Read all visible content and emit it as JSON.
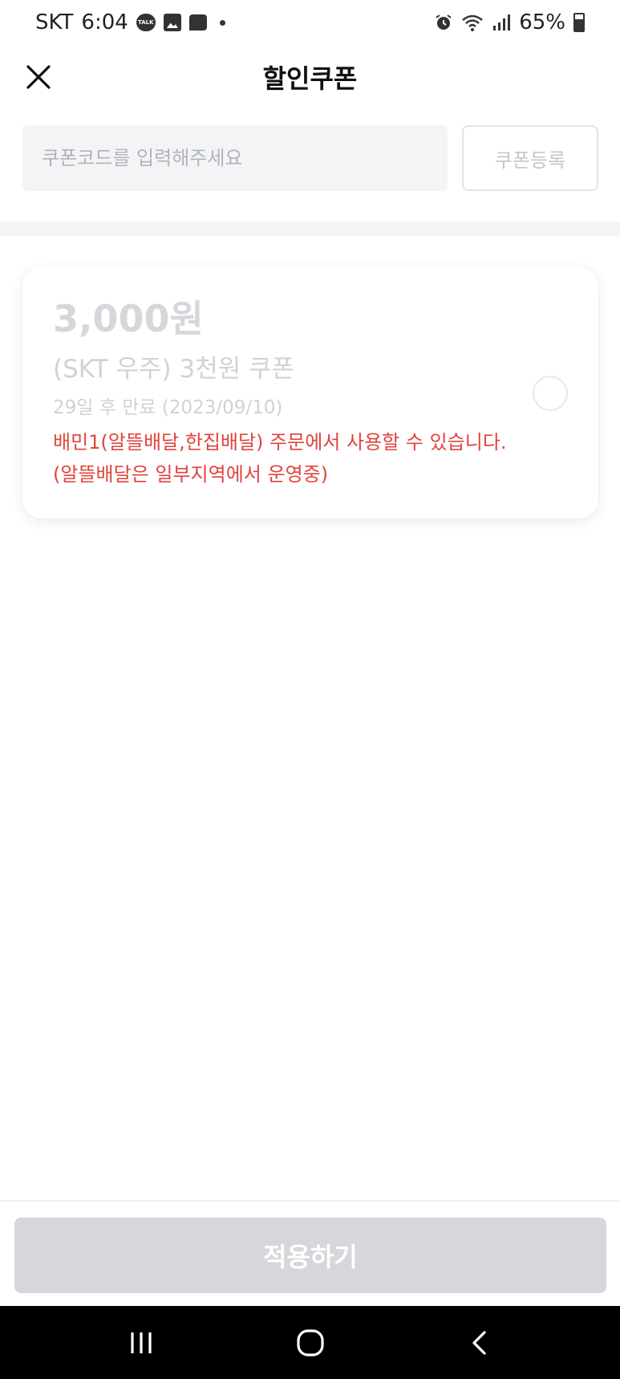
{
  "status_bar": {
    "carrier": "SKT",
    "time": "6:04",
    "talk_badge": "TALK",
    "battery": "65%"
  },
  "header": {
    "title": "할인쿠폰"
  },
  "coupon_register": {
    "placeholder": "쿠폰코드를 입력해주세요",
    "value": "",
    "button_label": "쿠폰등록"
  },
  "coupons": [
    {
      "amount": "3,000원",
      "name": "(SKT 우주) 3천원 쿠폰",
      "expiry": "29일 후 만료 (2023/09/10)",
      "notice_line1": "배민1(알뜰배달,한집배달) 주문에서 사용할 수 있습니다.",
      "notice_line2": "(알뜰배달은 일부지역에서 운영중)",
      "selected": false
    }
  ],
  "footer": {
    "apply_label": "적용하기"
  },
  "colors": {
    "notice": "#e0443e",
    "disabled_button": "#d5d7db",
    "disabled_text": "#cfd2d6"
  }
}
